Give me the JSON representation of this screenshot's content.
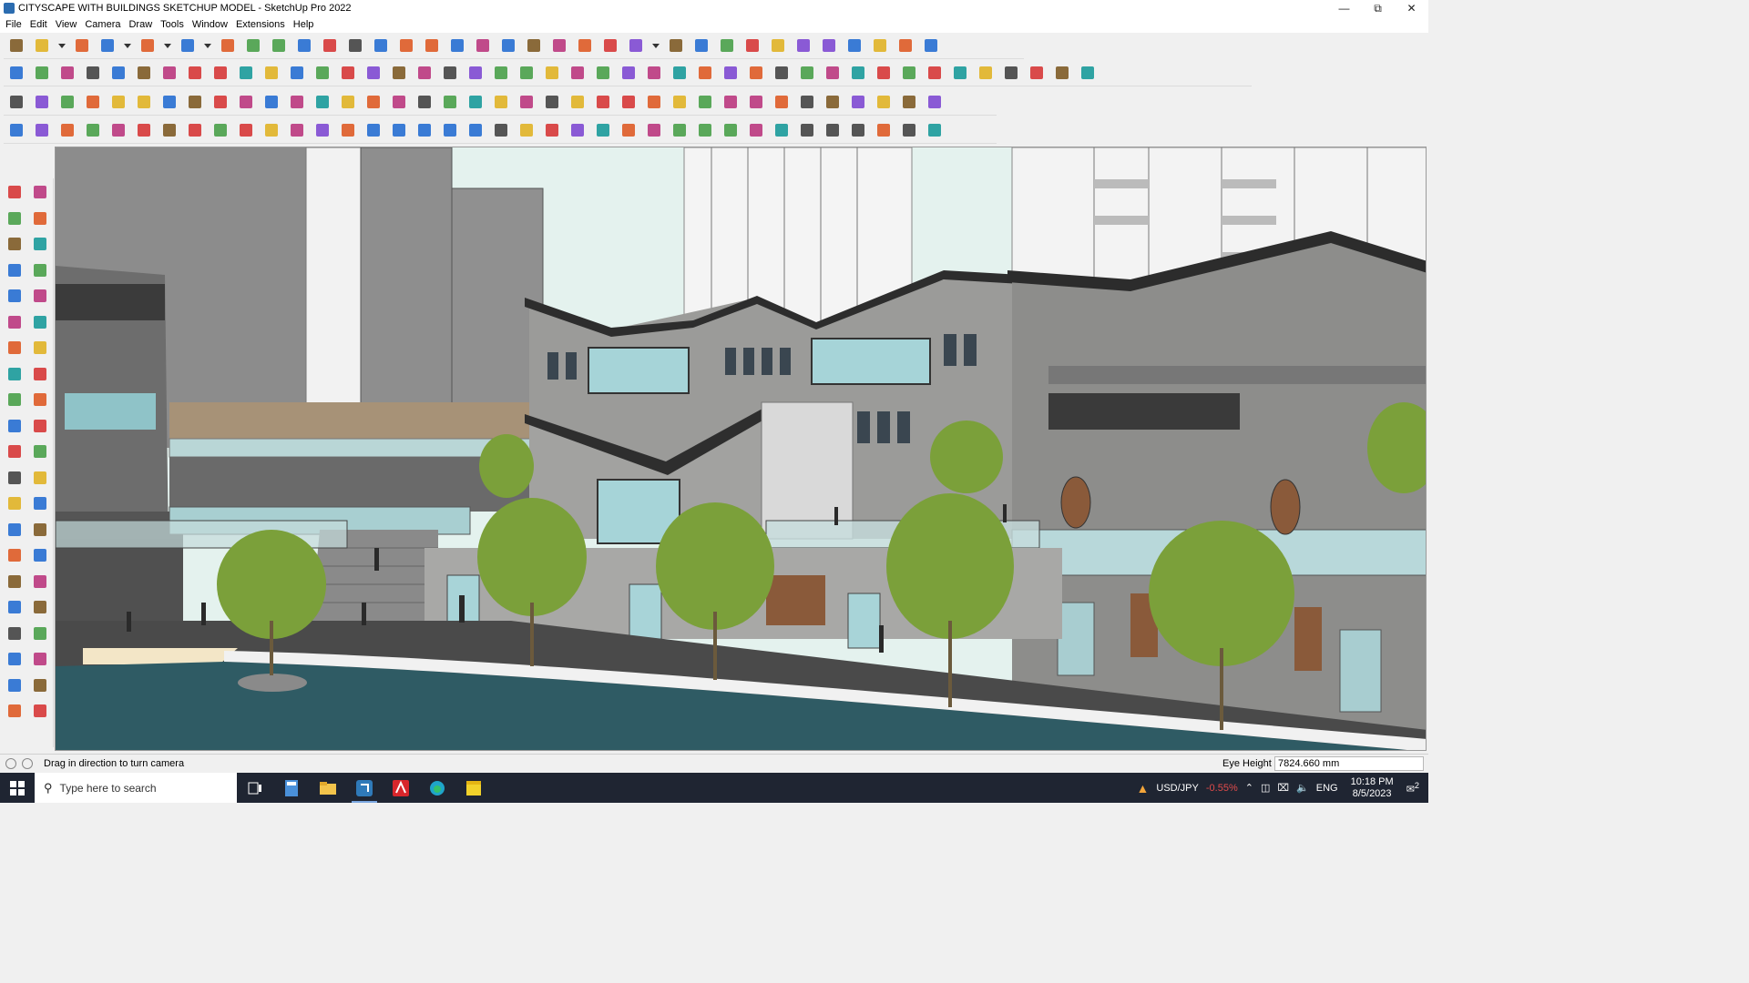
{
  "window": {
    "title": "CITYSCAPE WITH BUILDINGS SKETCHUP MODEL - SketchUp Pro 2022",
    "controls": [
      "—",
      "⧉",
      "✕"
    ]
  },
  "menu": [
    "File",
    "Edit",
    "View",
    "Camera",
    "Draw",
    "Tools",
    "Window",
    "Extensions",
    "Help"
  ],
  "toolbars": {
    "row1": [
      "zoom-icon",
      "select-arrow-icon",
      "dropdown-icon",
      "eraser-icon",
      "pencil-icon",
      "dropdown-icon",
      "lasso-icon",
      "dropdown-icon",
      "rectangle-icon",
      "dropdown-icon",
      "push-pull-icon",
      "paint-bucket-icon",
      "move-icon",
      "rotate-icon",
      "scale-icon",
      "tape-measure-icon",
      "text-icon",
      "paint-icon",
      "orbit-icon",
      "pan-icon",
      "zoom-window-icon",
      "zoom-extents-icon",
      "component-icon",
      "section-plane-icon",
      "layers-icon",
      "styles-icon",
      "user-icon",
      "dropdown-icon",
      "geo-location-icon",
      "import-icon",
      "flip-icon",
      "up-down-icon",
      "up-arrows-icon",
      "down-arrows-icon",
      "align-icon",
      "mirror-icon",
      "undo-icon",
      "redo-icon",
      "warehouse-icon"
    ],
    "row2": [
      "cube-icon",
      "solid-icon",
      "outer-shell-icon",
      "sandbox-icon",
      "intersect-icon",
      "union-icon",
      "subtract-icon",
      "trim-icon",
      "split-icon",
      "merge-icon",
      "shell-icon",
      "curve-icon",
      "offset-icon",
      "follow-me-icon",
      "extrude-icon",
      "lock-icon",
      "house-icon",
      "home-icon",
      "garage-icon",
      "house-outline-icon",
      "barn-icon",
      "function-icon",
      "tag-icon",
      "pencil-red-icon",
      "spline-icon",
      "circle-icon",
      "polygon-icon",
      "ellipse-icon",
      "parallelogram-icon",
      "arc-icon",
      "curve2-icon",
      "freehand-icon",
      "fillet-icon",
      "chamfer-icon",
      "red-line-icon",
      "eraser-pink-icon",
      "wall-icon",
      "grid-icon",
      "dimension-icon",
      "texture-icon",
      "cloth-icon",
      "material-icon",
      "warp-icon"
    ],
    "row3": [
      "blue-plane-icon",
      "blue-diamond-icon",
      "yellow-plane-icon",
      "green-plane-icon",
      "red-plane-icon",
      "white-plane-icon",
      "spiral-icon",
      "red-square-icon",
      "stack-icon",
      "panel-icon",
      "wood-icon",
      "link-icon",
      "arc-connector-icon",
      "joint-icon",
      "plus-icon",
      "green-plus-icon",
      "scissors-icon",
      "cone-icon",
      "tree-icon",
      "warning-icon",
      "lasso2-icon",
      "gear-icon",
      "circle-arrow-icon",
      "star-icon",
      "tube-icon",
      "magnet-icon",
      "grid-box-icon",
      "cube2-icon",
      "cubes-icon",
      "gift-icon",
      "gold-icon",
      "frame-icon",
      "orange-grid-icon",
      "checker-icon",
      "x-mark-icon",
      "circle-dots-icon",
      "group-icon"
    ],
    "row4": [
      "cut-tool-icon",
      "bezier-icon",
      "red-car-icon",
      "stitch-icon",
      "ring-icon",
      "ribbon-icon",
      "spring-icon",
      "box-outline-icon",
      "mesh-icon",
      "blade-icon",
      "line-angle-icon",
      "dash-icon",
      "bridge-icon",
      "half-circle-icon",
      "frame2-icon",
      "bridge2-icon",
      "cone-wire-icon",
      "pillars-icon",
      "columns-icon",
      "hand-icon",
      "leaf-icon",
      "spoke-icon",
      "fan-icon",
      "stairs-icon",
      "crosshatch-icon",
      "arrow-cluster-icon",
      "bin-icon",
      "tent-icon",
      "grille-icon",
      "grating-icon",
      "roof-icon",
      "pillars2-icon",
      "dome-icon",
      "dome2-icon",
      "ramp-icon",
      "fence-icon",
      "diamond-icon"
    ]
  },
  "lefttools": [
    "select-icon",
    "orbit-small-icon",
    "paint-bucket-icon",
    "eraser-icon",
    "component-icon",
    "tape-icon",
    "pencil-icon",
    "freehand-icon",
    "rectangle-icon",
    "rotated-rect-icon",
    "circle-icon",
    "polygon-icon",
    "arc-icon",
    "pie-icon",
    "two-point-arc-icon",
    "three-point-arc-icon",
    "move-icon",
    "push-pull-icon",
    "rotate-icon",
    "follow-me-icon",
    "scale-icon",
    "offset-icon",
    "tape-measure-icon",
    "dimension-icon",
    "protractor-icon",
    "text-icon",
    "axes-icon",
    "3d-text-icon",
    "orbit-icon",
    "pan-icon",
    "zoom-icon",
    "zoom-window-icon",
    "zoom-extents-icon",
    "previous-view-icon",
    "position-camera-icon",
    "look-around-icon",
    "walk-icon",
    "section-plane-icon",
    "warehouse-icon",
    "extension-icon",
    "layers-icon",
    "styles-icon"
  ],
  "status": {
    "message": "Drag in direction to turn camera",
    "vcb_label": "Eye Height",
    "vcb_value": "7824.660 mm"
  },
  "taskbar": {
    "search_placeholder": "Type here to search",
    "ticker_symbol": "USD/JPY",
    "ticker_change": "-0.55%",
    "lang": "ENG",
    "time": "10:18 PM",
    "date": "8/5/2023",
    "notifications": "2"
  },
  "colors": {
    "sky": "#e6f3ee",
    "water": "#2e5a63",
    "plaza": "#4a4a4a",
    "stone": "#9a9a98",
    "glass": "#9fd0d6",
    "roof": "#3a3a3a",
    "tree": "#7da23a",
    "ticker_red": "#e04b4b",
    "taskbar": "#1f2532"
  }
}
